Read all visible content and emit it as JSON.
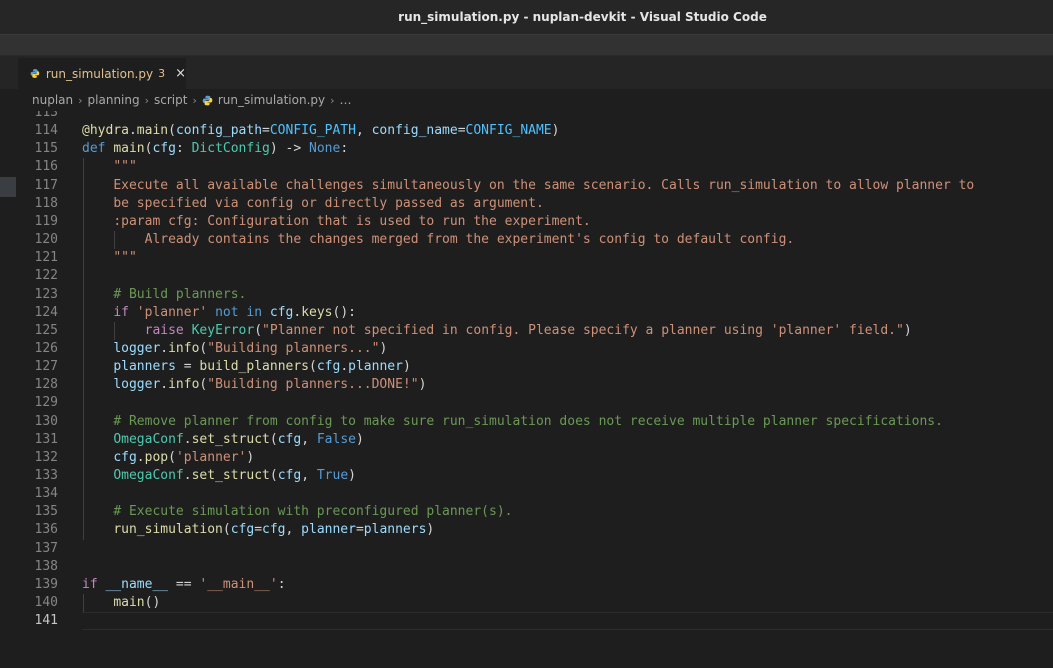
{
  "window": {
    "title": "run_simulation.py - nuplan-devkit - Visual Studio Code"
  },
  "tab": {
    "label": "run_simulation.py",
    "problems": "3",
    "close": "×"
  },
  "breadcrumb": {
    "items": [
      "nuplan",
      "planning",
      "script",
      "run_simulation.py",
      "…"
    ]
  },
  "editor": {
    "current_line": 141,
    "lines": [
      {
        "n": "113",
        "tokens": []
      },
      {
        "n": "114",
        "tokens": [
          [
            "fn",
            "@hydra"
          ],
          [
            "plain",
            "."
          ],
          [
            "fn",
            "main"
          ],
          [
            "plain",
            "("
          ],
          [
            "var",
            "config_path"
          ],
          [
            "plain",
            "="
          ],
          [
            "const",
            "CONFIG_PATH"
          ],
          [
            "plain",
            ", "
          ],
          [
            "var",
            "config_name"
          ],
          [
            "plain",
            "="
          ],
          [
            "const",
            "CONFIG_NAME"
          ],
          [
            "plain",
            ")"
          ]
        ]
      },
      {
        "n": "115",
        "tokens": [
          [
            "kw",
            "def"
          ],
          [
            "plain",
            " "
          ],
          [
            "fn",
            "main"
          ],
          [
            "plain",
            "("
          ],
          [
            "var",
            "cfg"
          ],
          [
            "plain",
            ": "
          ],
          [
            "cls",
            "DictConfig"
          ],
          [
            "plain",
            ") -> "
          ],
          [
            "kw",
            "None"
          ],
          [
            "plain",
            ":"
          ]
        ]
      },
      {
        "n": "116",
        "tokens": [
          [
            "plain",
            "    "
          ],
          [
            "str",
            "\"\"\""
          ]
        ]
      },
      {
        "n": "117",
        "tokens": [
          [
            "plain",
            "    "
          ],
          [
            "str",
            "Execute all available challenges simultaneously on the same scenario. Calls run_simulation to allow planner to"
          ]
        ]
      },
      {
        "n": "118",
        "tokens": [
          [
            "plain",
            "    "
          ],
          [
            "str",
            "be specified via config or directly passed as argument."
          ]
        ]
      },
      {
        "n": "119",
        "tokens": [
          [
            "plain",
            "    "
          ],
          [
            "str",
            ":param cfg: Configuration that is used to run the experiment."
          ]
        ]
      },
      {
        "n": "120",
        "tokens": [
          [
            "plain",
            "        "
          ],
          [
            "str",
            "Already contains the changes merged from the experiment's config to default config."
          ]
        ]
      },
      {
        "n": "121",
        "tokens": [
          [
            "plain",
            "    "
          ],
          [
            "str",
            "\"\"\""
          ]
        ]
      },
      {
        "n": "122",
        "tokens": []
      },
      {
        "n": "123",
        "tokens": [
          [
            "plain",
            "    "
          ],
          [
            "cmt",
            "# Build planners."
          ]
        ]
      },
      {
        "n": "124",
        "tokens": [
          [
            "plain",
            "    "
          ],
          [
            "ctl",
            "if"
          ],
          [
            "plain",
            " "
          ],
          [
            "str",
            "'planner'"
          ],
          [
            "plain",
            " "
          ],
          [
            "kw",
            "not"
          ],
          [
            "plain",
            " "
          ],
          [
            "kw",
            "in"
          ],
          [
            "plain",
            " "
          ],
          [
            "var",
            "cfg"
          ],
          [
            "plain",
            "."
          ],
          [
            "fn",
            "keys"
          ],
          [
            "plain",
            "():"
          ]
        ]
      },
      {
        "n": "125",
        "tokens": [
          [
            "plain",
            "        "
          ],
          [
            "ctl",
            "raise"
          ],
          [
            "plain",
            " "
          ],
          [
            "cls",
            "KeyError"
          ],
          [
            "plain",
            "("
          ],
          [
            "str",
            "\"Planner not specified in config. Please specify a planner using 'planner' field.\""
          ],
          [
            "plain",
            ")"
          ]
        ]
      },
      {
        "n": "126",
        "tokens": [
          [
            "plain",
            "    "
          ],
          [
            "var",
            "logger"
          ],
          [
            "plain",
            "."
          ],
          [
            "fn",
            "info"
          ],
          [
            "plain",
            "("
          ],
          [
            "str",
            "\"Building planners...\""
          ],
          [
            "plain",
            ")"
          ]
        ]
      },
      {
        "n": "127",
        "tokens": [
          [
            "plain",
            "    "
          ],
          [
            "var",
            "planners"
          ],
          [
            "plain",
            " = "
          ],
          [
            "fn",
            "build_planners"
          ],
          [
            "plain",
            "("
          ],
          [
            "var",
            "cfg"
          ],
          [
            "plain",
            "."
          ],
          [
            "var",
            "planner"
          ],
          [
            "plain",
            ")"
          ]
        ]
      },
      {
        "n": "128",
        "tokens": [
          [
            "plain",
            "    "
          ],
          [
            "var",
            "logger"
          ],
          [
            "plain",
            "."
          ],
          [
            "fn",
            "info"
          ],
          [
            "plain",
            "("
          ],
          [
            "str",
            "\"Building planners...DONE!\""
          ],
          [
            "plain",
            ")"
          ]
        ]
      },
      {
        "n": "129",
        "tokens": []
      },
      {
        "n": "130",
        "tokens": [
          [
            "plain",
            "    "
          ],
          [
            "cmt",
            "# Remove planner from config to make sure run_simulation does not receive multiple planner specifications."
          ]
        ]
      },
      {
        "n": "131",
        "tokens": [
          [
            "plain",
            "    "
          ],
          [
            "cls",
            "OmegaConf"
          ],
          [
            "plain",
            "."
          ],
          [
            "fn",
            "set_struct"
          ],
          [
            "plain",
            "("
          ],
          [
            "var",
            "cfg"
          ],
          [
            "plain",
            ", "
          ],
          [
            "kw",
            "False"
          ],
          [
            "plain",
            ")"
          ]
        ]
      },
      {
        "n": "132",
        "tokens": [
          [
            "plain",
            "    "
          ],
          [
            "var",
            "cfg"
          ],
          [
            "plain",
            "."
          ],
          [
            "fn",
            "pop"
          ],
          [
            "plain",
            "("
          ],
          [
            "str",
            "'planner'"
          ],
          [
            "plain",
            ")"
          ]
        ]
      },
      {
        "n": "133",
        "tokens": [
          [
            "plain",
            "    "
          ],
          [
            "cls",
            "OmegaConf"
          ],
          [
            "plain",
            "."
          ],
          [
            "fn",
            "set_struct"
          ],
          [
            "plain",
            "("
          ],
          [
            "var",
            "cfg"
          ],
          [
            "plain",
            ", "
          ],
          [
            "kw",
            "True"
          ],
          [
            "plain",
            ")"
          ]
        ]
      },
      {
        "n": "134",
        "tokens": []
      },
      {
        "n": "135",
        "tokens": [
          [
            "plain",
            "    "
          ],
          [
            "cmt",
            "# Execute simulation with preconfigured planner(s)."
          ]
        ]
      },
      {
        "n": "136",
        "tokens": [
          [
            "plain",
            "    "
          ],
          [
            "fn",
            "run_simulation"
          ],
          [
            "plain",
            "("
          ],
          [
            "var",
            "cfg"
          ],
          [
            "plain",
            "="
          ],
          [
            "var",
            "cfg"
          ],
          [
            "plain",
            ", "
          ],
          [
            "var",
            "planner"
          ],
          [
            "plain",
            "="
          ],
          [
            "var",
            "planners"
          ],
          [
            "plain",
            ")"
          ]
        ]
      },
      {
        "n": "137",
        "tokens": []
      },
      {
        "n": "138",
        "tokens": []
      },
      {
        "n": "139",
        "tokens": [
          [
            "ctl",
            "if"
          ],
          [
            "plain",
            " "
          ],
          [
            "var",
            "__name__"
          ],
          [
            "plain",
            " == "
          ],
          [
            "str",
            "'__main__'"
          ],
          [
            "plain",
            ":"
          ]
        ]
      },
      {
        "n": "140",
        "tokens": [
          [
            "plain",
            "    "
          ],
          [
            "fn",
            "main"
          ],
          [
            "plain",
            "()"
          ]
        ]
      },
      {
        "n": "141",
        "tokens": []
      }
    ]
  },
  "colors": {
    "editor_bg": "#1e1e1e",
    "keyword": "#569cd6",
    "control": "#c586c0",
    "function": "#dcdcaa",
    "string": "#ce9178",
    "comment": "#6a9955",
    "variable": "#9cdcfe",
    "class": "#4ec9b0",
    "modified_tab": "#e2c08d"
  }
}
